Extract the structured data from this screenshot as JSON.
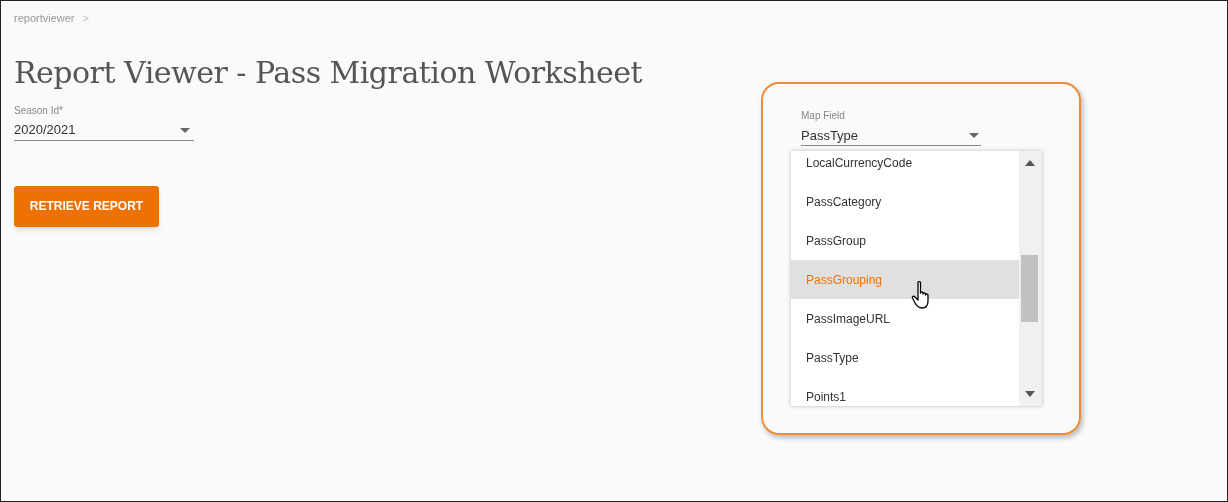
{
  "breadcrumb": {
    "label": "reportviewer",
    "separator": ">"
  },
  "title": "Report Viewer - Pass Migration Worksheet",
  "season_field": {
    "label": "Season Id*",
    "value": "2020/2021"
  },
  "retrieve_button": {
    "label": "RETRIEVE REPORT"
  },
  "map_field": {
    "label": "Map Field",
    "value": "PassType"
  },
  "dropdown_options": [
    {
      "label": "LocalCurrencyCode",
      "hovered": false
    },
    {
      "label": "PassCategory",
      "hovered": false
    },
    {
      "label": "PassGroup",
      "hovered": false
    },
    {
      "label": "PassGrouping",
      "hovered": true
    },
    {
      "label": "PassImageURL",
      "hovered": false
    },
    {
      "label": "PassType",
      "hovered": false
    },
    {
      "label": "Points1",
      "hovered": false
    }
  ]
}
